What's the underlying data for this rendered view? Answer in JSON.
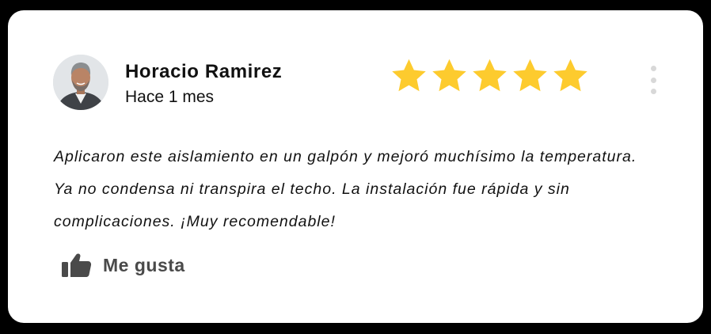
{
  "review": {
    "author": "Horacio Ramirez",
    "time_ago": "Hace 1 mes",
    "rating": 5,
    "rating_max": 5,
    "text": "Aplicaron este aislamiento en un galpón y mejoró muchísimo la tempe­ratura. Ya no condensa ni transpira el techo. La instalación fue rápida y sin complicaciones. ¡Muy recomendable!",
    "like_label": "Me gusta"
  },
  "colors": {
    "star": "#fdcb2e",
    "background": "#000000",
    "card": "#ffffff",
    "text": "#111111",
    "like": "#4a4a4a",
    "menu_dots": "#d8d8d8"
  },
  "icons": {
    "avatar": "user-photo",
    "star": "star-icon",
    "more": "more-vertical-icon",
    "like": "thumbs-up-icon"
  }
}
